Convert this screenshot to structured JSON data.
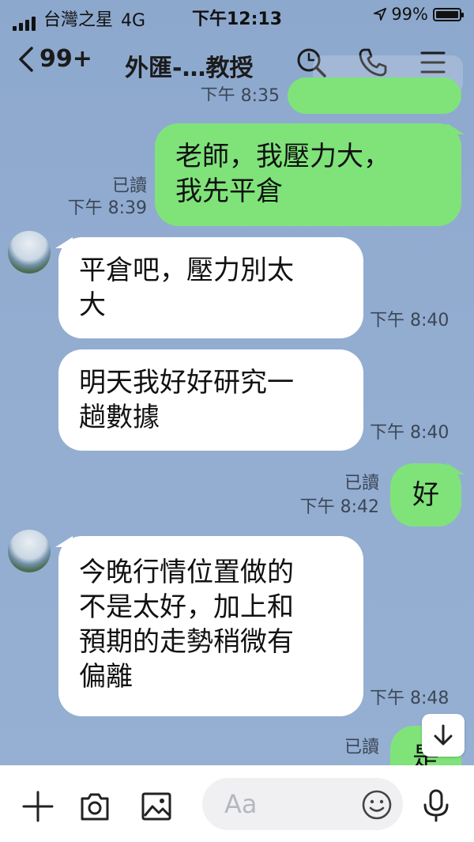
{
  "status_bar": {
    "carrier": "台灣之星",
    "network": "4G",
    "time": "下午12:13",
    "battery": "99%"
  },
  "header": {
    "back_count": "99+",
    "title": "外匯-…教授"
  },
  "messages": [
    {
      "side": "right",
      "lines": [
        "老師，我壓力大，",
        "我先平倉"
      ],
      "read": "已讀",
      "time": "下午 8:39"
    },
    {
      "side": "left",
      "lines": [
        "平倉吧，壓力別太",
        "大"
      ],
      "time": "下午 8:40"
    },
    {
      "side": "left",
      "lines": [
        "明天我好好研究一",
        "趟數據"
      ],
      "time": "下午 8:40"
    },
    {
      "side": "right",
      "lines": [
        "好"
      ],
      "read": "已讀",
      "time": "下午 8:42"
    },
    {
      "side": "left",
      "lines": [
        "今晚行情位置做的",
        "不是太好，加上和",
        "預期的走勢稍微有",
        "偏離"
      ],
      "time": "下午 8:48"
    },
    {
      "side": "right",
      "lines": [
        "是"
      ],
      "read": "已讀"
    }
  ],
  "partial_top": {
    "time": "下午 8:35"
  },
  "input": {
    "placeholder": "Aa"
  },
  "colors": {
    "green_bubble": "#7fe37a",
    "background": "#93add1"
  }
}
